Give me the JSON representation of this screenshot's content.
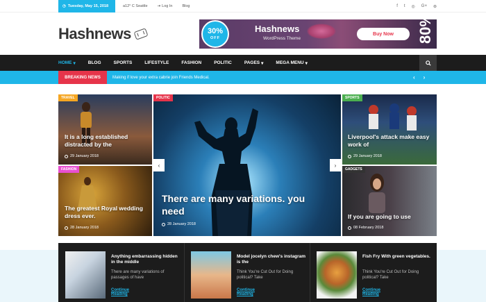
{
  "topbar": {
    "date": "Tuesday, May 15, 2018",
    "weather": "a12° C Seattle",
    "login": "Log In",
    "blog": "Blog",
    "social_icons": [
      "facebook-icon",
      "twitter-icon",
      "instagram-icon",
      "google-plus-icon",
      "dribbble-icon"
    ],
    "social_glyphs": [
      "f",
      "t",
      "◎",
      "G+",
      "⊛"
    ]
  },
  "header": {
    "logo": "Hashnews",
    "banner": {
      "percent": "30%",
      "off": "OFF",
      "title": "Hashnews",
      "subtitle": "WordPress Theme",
      "button": "Buy Now",
      "big_text": "80%"
    }
  },
  "nav": {
    "items": [
      {
        "label": "HOME",
        "caret": "▾"
      },
      {
        "label": "BLOG",
        "caret": ""
      },
      {
        "label": "SPORTS",
        "caret": ""
      },
      {
        "label": "LIFESTYLE",
        "caret": ""
      },
      {
        "label": "FASHION",
        "caret": ""
      },
      {
        "label": "POLITIC",
        "caret": ""
      },
      {
        "label": "PAGES",
        "caret": "▾"
      },
      {
        "label": "MEGA MENU",
        "caret": "▾"
      }
    ]
  },
  "breaking": {
    "label": "BREAKING NEWS",
    "text": "Making if love your extra cabrie join Friends Medical.",
    "prev": "‹",
    "next": "›"
  },
  "grid": {
    "travel": {
      "tag": "TRAVEL",
      "title": "It is a long established distracted by the",
      "date": "29 January 2018",
      "tag_color": "#f5a623"
    },
    "fashion": {
      "tag": "FASHION",
      "title": "The greatest Royal wedding dress ever.",
      "date": "28 January 2018",
      "tag_color": "#e84fd1"
    },
    "politic": {
      "tag": "POLITIC",
      "title": "There are many variations. you need",
      "date": "28 January 2018",
      "tag_color": "#e6344a"
    },
    "sports": {
      "tag": "SPORTS",
      "title": "Liverpool's attack make easy work of",
      "date": "29 January 2018",
      "tag_color": "#4caf50"
    },
    "gadgets": {
      "tag": "GADGETS",
      "title": "If you are going to use",
      "date": "08 February 2018",
      "tag_color": "#333333"
    },
    "prev_arrow": "‹",
    "next_arrow": "›"
  },
  "bottom": [
    {
      "title": "Anything embarrassing hidden in the middle",
      "excerpt": "There are many variations of passages of have",
      "link": "Continue Reading"
    },
    {
      "title": "Model jocelyn chew's instagram is the",
      "excerpt": "Think You're Cut Out for Doing political? Take",
      "link": "Continue Reading"
    },
    {
      "title": "Fish Fry With green vegetables.",
      "excerpt": "Think You're Cut Out for Doing political? Take",
      "link": "Continue Reading"
    }
  ],
  "colors": {
    "accent": "#1fb6e8",
    "breaking_red": "#e6344a",
    "nav_bg": "#1c1c1c"
  }
}
